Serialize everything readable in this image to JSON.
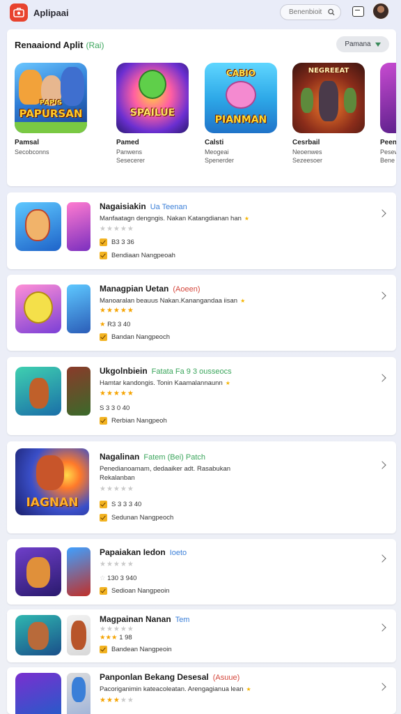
{
  "header": {
    "app_name": "Aplipaai",
    "search_placeholder": "Benenbioit",
    "icons": {
      "logo": "app-logo-icon",
      "search": "search-icon",
      "messages": "message-icon",
      "avatar": "user-avatar"
    }
  },
  "featured": {
    "title": "Renaaiond Aplit",
    "tag": "(Rai)",
    "filter_label": "Pamana",
    "cards": [
      {
        "poster_top": "PAPIS",
        "poster_text": "PAPURSAN",
        "name": "Pamsal",
        "sub1": "Secobconns",
        "sub2": ""
      },
      {
        "poster_top": "",
        "poster_text": "SPAILUE",
        "name": "Pamed",
        "sub1": "Panwens",
        "sub2": "Sesecerer"
      },
      {
        "poster_top": "CABIO",
        "poster_text": "PIANMAN",
        "name": "Calsti",
        "sub1": "Meogeai",
        "sub2": "Spenerder"
      },
      {
        "poster_top": "NEGREEAT",
        "poster_text": "",
        "name": "Cesrbail",
        "sub1": "Neoenwes",
        "sub2": "Sezeesoer"
      },
      {
        "poster_top": "",
        "poster_text": "",
        "name": "Peen",
        "sub1": "Pesew",
        "sub2": "Bene"
      }
    ]
  },
  "rows": [
    {
      "title": "Nagaisiakin",
      "badge": "Ua Teenan",
      "badge_color": "#3b7fd8",
      "desc": "Manfaatagn dengngis. Nakan Katangdianan han",
      "stars": 0,
      "stat": "B3 3 36",
      "check": "Bendiaan Nangpeoah"
    },
    {
      "title": "Managpian Uetan",
      "badge": "(Aoeen)",
      "badge_color": "#d4463b",
      "desc": "Manoaralan beauus Nakan.Kanangandaa iisan",
      "stars": 5,
      "stat": "R3 3 40",
      "check": "Bandan Nangpeoch"
    },
    {
      "title": "Ukgolnbiein",
      "badge": "Fatata Fa 9 3 ousseocs",
      "badge_color": "#3aa55b",
      "desc": "Hamtar kandongis. Tonin Kaamalannaunn",
      "stars": 5,
      "stat": "S 3 3 0 40",
      "check": "Rerbian Nangpeoh"
    },
    {
      "title": "Nagalinan",
      "badge": "Fatem (Bei) Patch",
      "badge_color": "#3aa55b",
      "desc": "Penedianoamam, dedaaiker adt. Rasabukan",
      "desc2": "Rekalanban",
      "stars": 0,
      "stat": "S 3 3 3 40",
      "check": "Sedunan Nangpeoch"
    },
    {
      "title": "Papaiakan Iedon",
      "badge": "Ioeto",
      "badge_color": "#3b7fd8",
      "desc": "",
      "stars": 1,
      "stat": "130 3 940",
      "check": "Sedioan Nangpeoin"
    },
    {
      "title": "Magpainan Nanan",
      "badge": "Tem",
      "badge_color": "#3b7fd8",
      "desc": "",
      "stars": 3,
      "stat": "1 98",
      "check": "Bandean Nangpeoin"
    },
    {
      "title": "Panponlan Bekang Desesal",
      "badge": "(Asuue)",
      "badge_color": "#d4463b",
      "desc": "Pacoriganimin kateacoleatan. Arengagianua lean",
      "stars": 3,
      "stat": "",
      "check": ""
    }
  ]
}
